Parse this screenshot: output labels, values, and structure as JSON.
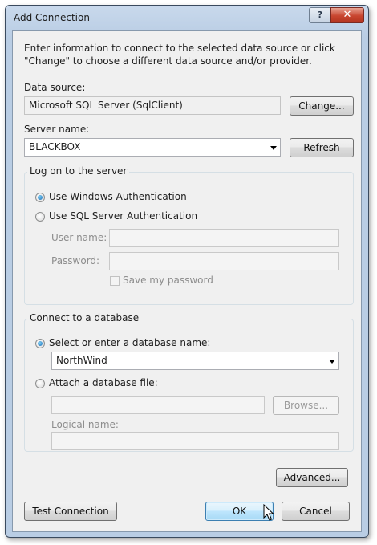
{
  "window": {
    "title": "Add Connection",
    "help_label": "?",
    "close_label": "✕"
  },
  "intro_text": "Enter information to connect to the selected data source or click \"Change\" to choose a different data source and/or provider.",
  "data_source": {
    "label": "Data source:",
    "value": "Microsoft SQL Server (SqlClient)",
    "change_button": "Change..."
  },
  "server": {
    "label": "Server name:",
    "value": "BLACKBOX",
    "refresh_button": "Refresh"
  },
  "logon": {
    "group_label": "Log on to the server",
    "windows_auth_label": "Use Windows Authentication",
    "windows_auth_checked": true,
    "sql_auth_label": "Use SQL Server Authentication",
    "sql_auth_checked": false,
    "username_label": "User name:",
    "username_value": "",
    "password_label": "Password:",
    "password_value": "",
    "save_password_label": "Save my password",
    "save_password_checked": false
  },
  "database": {
    "group_label": "Connect to a database",
    "select_label": "Select or enter a database name:",
    "select_checked": true,
    "database_name": "NorthWind",
    "attach_label": "Attach a database file:",
    "attach_checked": false,
    "attach_file_value": "",
    "browse_button": "Browse...",
    "logical_name_label": "Logical name:",
    "logical_name_value": ""
  },
  "buttons": {
    "advanced": "Advanced...",
    "test_connection": "Test Connection",
    "ok": "OK",
    "cancel": "Cancel"
  },
  "icons": {
    "dropdown": "chevron-down-icon",
    "pointer": "mouse-pointer-icon"
  }
}
